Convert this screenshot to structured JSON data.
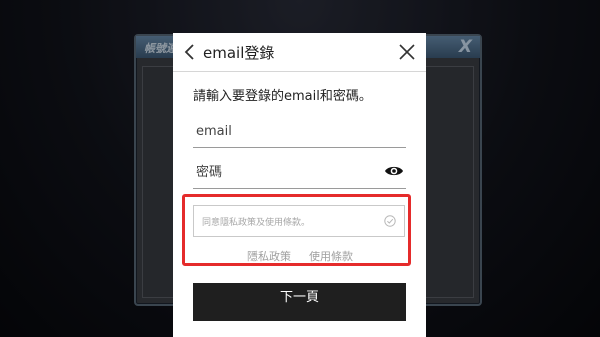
{
  "background_window": {
    "title": "帳號連",
    "close_glyph": "X"
  },
  "dialog": {
    "title": "email登錄",
    "instruction": "請輸入要登錄的email和密碼。",
    "email_placeholder": "email",
    "password_placeholder": "密碼",
    "agree_text": "同意隱私政策及使用條款。",
    "privacy_link": "隱私政策",
    "terms_link": "使用條款",
    "next_button": "下一頁"
  },
  "icons": {
    "back": "chevron-left-icon",
    "close": "close-icon",
    "password_visibility": "eye-icon",
    "agree_check": "check-circle-icon"
  },
  "colors": {
    "highlight_frame": "#e52b2b",
    "button_bg": "#1f1f1f"
  }
}
